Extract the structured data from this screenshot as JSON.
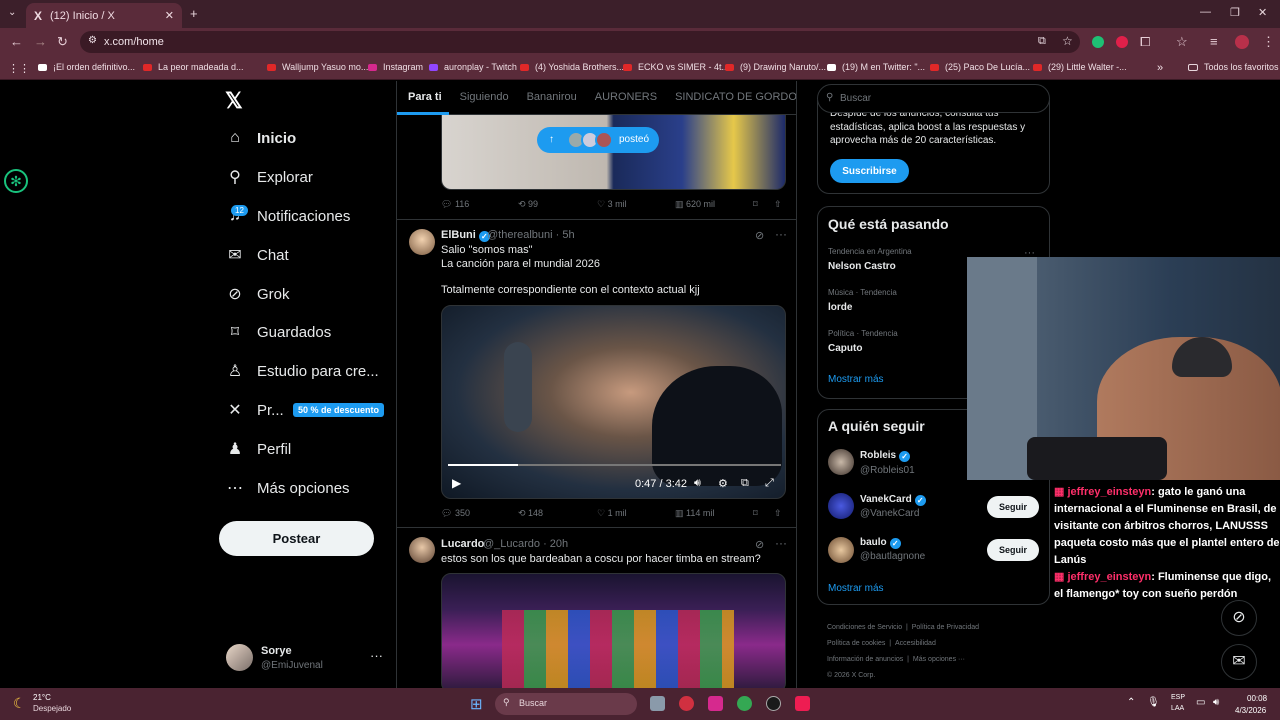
{
  "browser": {
    "tab_title": "(12) Inicio / X",
    "url": "x.com/home",
    "bookmarks": [
      "¡El orden definitivo...",
      "La peor madeada d...",
      "Walljump Yasuo mo...",
      "Instagram",
      "auronplay - Twitch",
      "(4) Yoshida Brothers...",
      "ECKO vs SIMER - 4t...",
      "(9) Drawing Naruto/...",
      "(19) M en Twitter: \"...",
      "(25) Paco De Lucía...",
      "(29) Little Walter -..."
    ],
    "bookmarks_all": "Todos los favoritos"
  },
  "nav": {
    "items": [
      {
        "label": "Inicio",
        "icon": "home-icon"
      },
      {
        "label": "Explorar",
        "icon": "search-icon"
      },
      {
        "label": "Notificaciones",
        "icon": "bell-icon"
      },
      {
        "label": "Chat",
        "icon": "mail-icon"
      },
      {
        "label": "Grok",
        "icon": "grok-icon"
      },
      {
        "label": "Guardados",
        "icon": "bookmark-icon"
      },
      {
        "label": "Estudio para cre...",
        "icon": "studio-icon"
      },
      {
        "label": "Pr...",
        "icon": "x-icon"
      },
      {
        "label": "Perfil",
        "icon": "person-icon"
      },
      {
        "label": "Más opciones",
        "icon": "more-icon"
      }
    ],
    "notif_badge": "12",
    "promo": "50 % de descuento",
    "post_button": "Postear",
    "account": {
      "name": "Sorye",
      "handle": "@EmiJuvenal"
    }
  },
  "timeline": {
    "tabs": [
      "Para ti",
      "Siguiendo",
      "Bananirou",
      "AURONERS",
      "SINDICATO DE GORDOS V"
    ],
    "new_posts_pill": "posteó",
    "post0": {
      "actions": {
        "replies": "116",
        "reposts": "99",
        "likes": "3 mil",
        "views": "620 mil"
      }
    },
    "post1": {
      "name": "ElBuni",
      "handle": "@therealbuni · 5h",
      "text1": "Salio \"somos mas\"",
      "text2": "La canción para el mundial 2026",
      "text3": "Totalmente correspondiente con el contexto actual kjj",
      "video_time": "0:47 / 3:42",
      "actions": {
        "replies": "350",
        "reposts": "148",
        "likes": "1 mil",
        "views": "114 mil"
      }
    },
    "post2": {
      "name": "Lucardo",
      "handle": "@_Lucardo · 20h",
      "text": "estos son los que bardeaban a coscu por hacer timba en stream?"
    }
  },
  "right": {
    "search_placeholder": "Buscar",
    "premium": {
      "text": "Despíde de los anuncios, consulta tus estadísticas, aplica boost a las respuestas y aprovecha más de 20 características.",
      "button": "Suscribirse"
    },
    "trends": {
      "title": "Qué está pasando",
      "items": [
        {
          "context": "Tendencia en Argentina",
          "name": "Nelson Castro"
        },
        {
          "context": "Música · Tendencia",
          "name": "lorde"
        },
        {
          "context": "Política · Tendencia",
          "name": "Caputo"
        }
      ],
      "more": "Mostrar más"
    },
    "follow": {
      "title": "A quién seguir",
      "items": [
        {
          "name": "Robleis",
          "handle": "@Robleis01"
        },
        {
          "name": "VanekCard",
          "handle": "@VanekCard",
          "button": "Seguir"
        },
        {
          "name": "baulo",
          "handle": "@bautlagnone",
          "button": "Seguir"
        }
      ],
      "more": "Mostrar más"
    },
    "footer": [
      "Condiciones de Servicio",
      "Política de Privacidad",
      "Política de cookies",
      "Accesibilidad",
      "Información de anuncios",
      "Más opciones ···",
      "© 2026 X Corp."
    ]
  },
  "chat": [
    {
      "user": "jeffrey_einsteyn",
      "msg": ": gato le ganó una internacional a el Fluminense en Brasil, de visitante con árbitros chorros, LANUSSS paqueta costo más que el plantel entero de Lanús"
    },
    {
      "user": "jeffrey_einsteyn",
      "msg": ": Fluminense que digo, el flamengo* toy con sueño perdón"
    }
  ],
  "taskbar": {
    "weather_temp": "21°C",
    "weather_desc": "Despejado",
    "search": "Buscar",
    "lang1": "ESP",
    "lang2": "LAA",
    "time": "00:08",
    "date": "4/3/2026"
  }
}
